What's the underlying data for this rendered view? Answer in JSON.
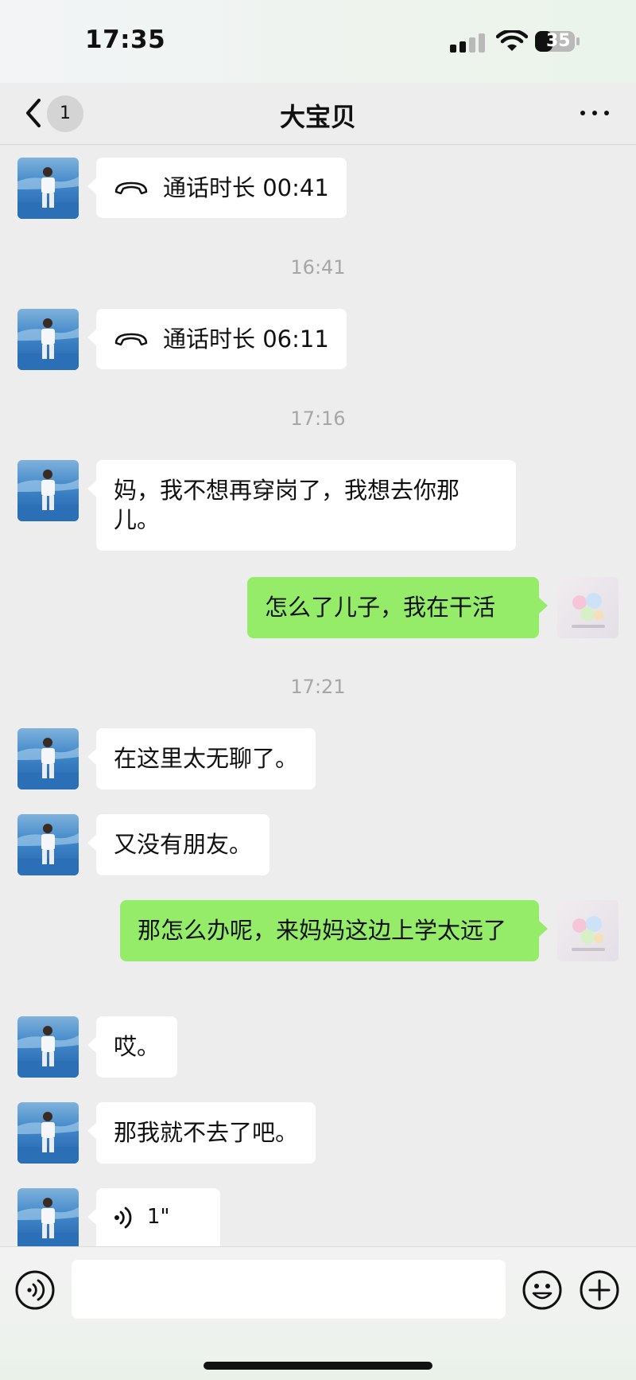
{
  "status_bar": {
    "time": "17:35",
    "battery": "35"
  },
  "nav": {
    "back_badge": "1",
    "title": "大宝贝"
  },
  "messages": [
    {
      "call_text": "通话时长 00:41"
    },
    {
      "time": "16:41"
    },
    {
      "call_text": "通话时长 06:11"
    },
    {
      "time": "17:16"
    },
    {
      "text": "妈，我不想再穿岗了，我想去你那儿。"
    },
    {
      "text": "怎么了儿子，我在干活"
    },
    {
      "time": "17:21"
    },
    {
      "text": "在这里太无聊了。"
    },
    {
      "text": "又没有朋友。"
    },
    {
      "text": "那怎么办呢，来妈妈这边上学太远了"
    },
    {
      "text": "哎。"
    },
    {
      "text": "那我就不去了吧。"
    },
    {
      "voice_duration": "1\""
    }
  ],
  "input": {
    "placeholder": ""
  },
  "colors": {
    "outgoing_bubble": "#95ec69",
    "incoming_bubble": "#ffffff",
    "background": "#ededed"
  }
}
